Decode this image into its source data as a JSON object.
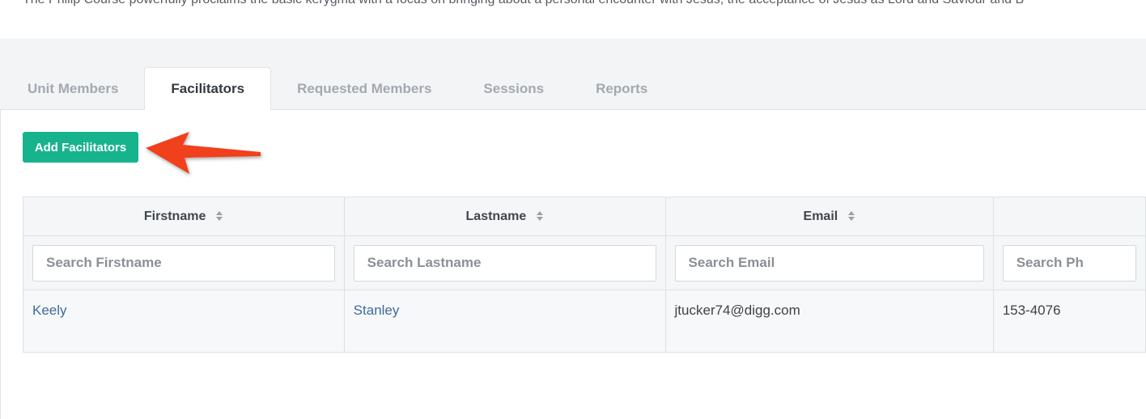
{
  "intro_text": "The Philip Course powerfully proclaims the basic kerygma with a focus on bringing about a personal encounter with Jesus, the acceptance of Jesus as Lord and Saviour and B",
  "tabs": [
    {
      "label": "Unit Members",
      "active": false
    },
    {
      "label": "Facilitators",
      "active": true
    },
    {
      "label": "Requested Members",
      "active": false
    },
    {
      "label": "Sessions",
      "active": false
    },
    {
      "label": "Reports",
      "active": false
    }
  ],
  "add_button": {
    "label": "Add Facilitators"
  },
  "colors": {
    "accent": "#17b38d",
    "arrow": "#f0401e",
    "link": "#3d6b99"
  },
  "table": {
    "columns": [
      {
        "label": "Firstname",
        "search_placeholder": "Search Firstname"
      },
      {
        "label": "Lastname",
        "search_placeholder": "Search Lastname"
      },
      {
        "label": "Email",
        "search_placeholder": "Search Email"
      },
      {
        "label": "",
        "search_placeholder": "Search Ph"
      }
    ],
    "rows": [
      {
        "firstname": "Keely",
        "lastname": "Stanley",
        "email": "jtucker74@digg.com",
        "phone": "153-4076"
      }
    ]
  }
}
